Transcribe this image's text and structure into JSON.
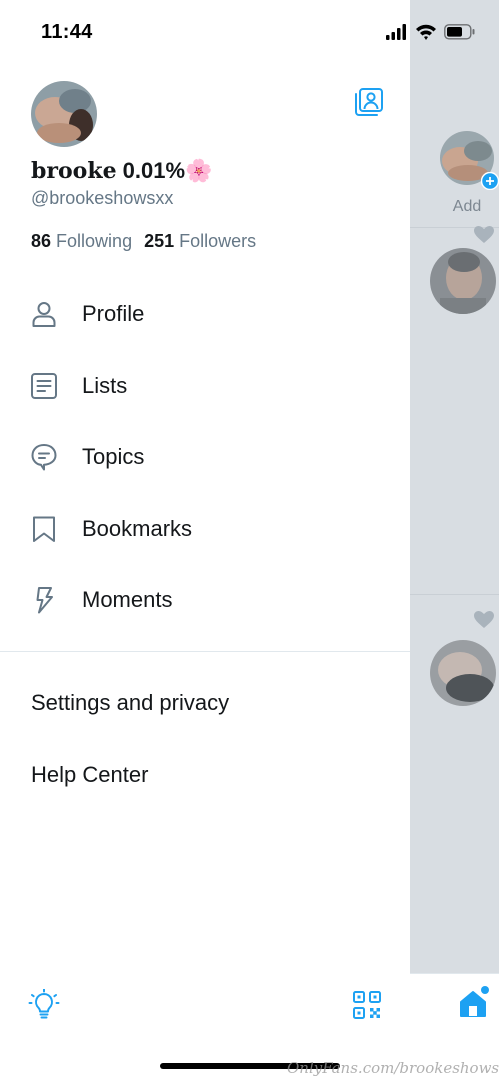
{
  "status_bar": {
    "time": "11:44"
  },
  "profile": {
    "name_serif": "brooke",
    "name_bold": " 0.01%",
    "name_emoji": "🌸",
    "handle": "@brookeshowsxx",
    "following_count": "86",
    "following_label": "Following",
    "followers_count": "251",
    "followers_label": "Followers"
  },
  "menu": {
    "items": [
      {
        "label": "Profile",
        "icon": "person-icon"
      },
      {
        "label": "Lists",
        "icon": "list-icon"
      },
      {
        "label": "Topics",
        "icon": "topics-icon"
      },
      {
        "label": "Bookmarks",
        "icon": "bookmark-icon"
      },
      {
        "label": "Moments",
        "icon": "lightning-icon"
      }
    ],
    "settings": "Settings and privacy",
    "help": "Help Center"
  },
  "background": {
    "add_label": "Add"
  },
  "watermark": "OnlyFans.com/brookeshowsxx",
  "colors": {
    "accent": "#1da1f2",
    "text": "#14171a",
    "secondary": "#657786"
  }
}
